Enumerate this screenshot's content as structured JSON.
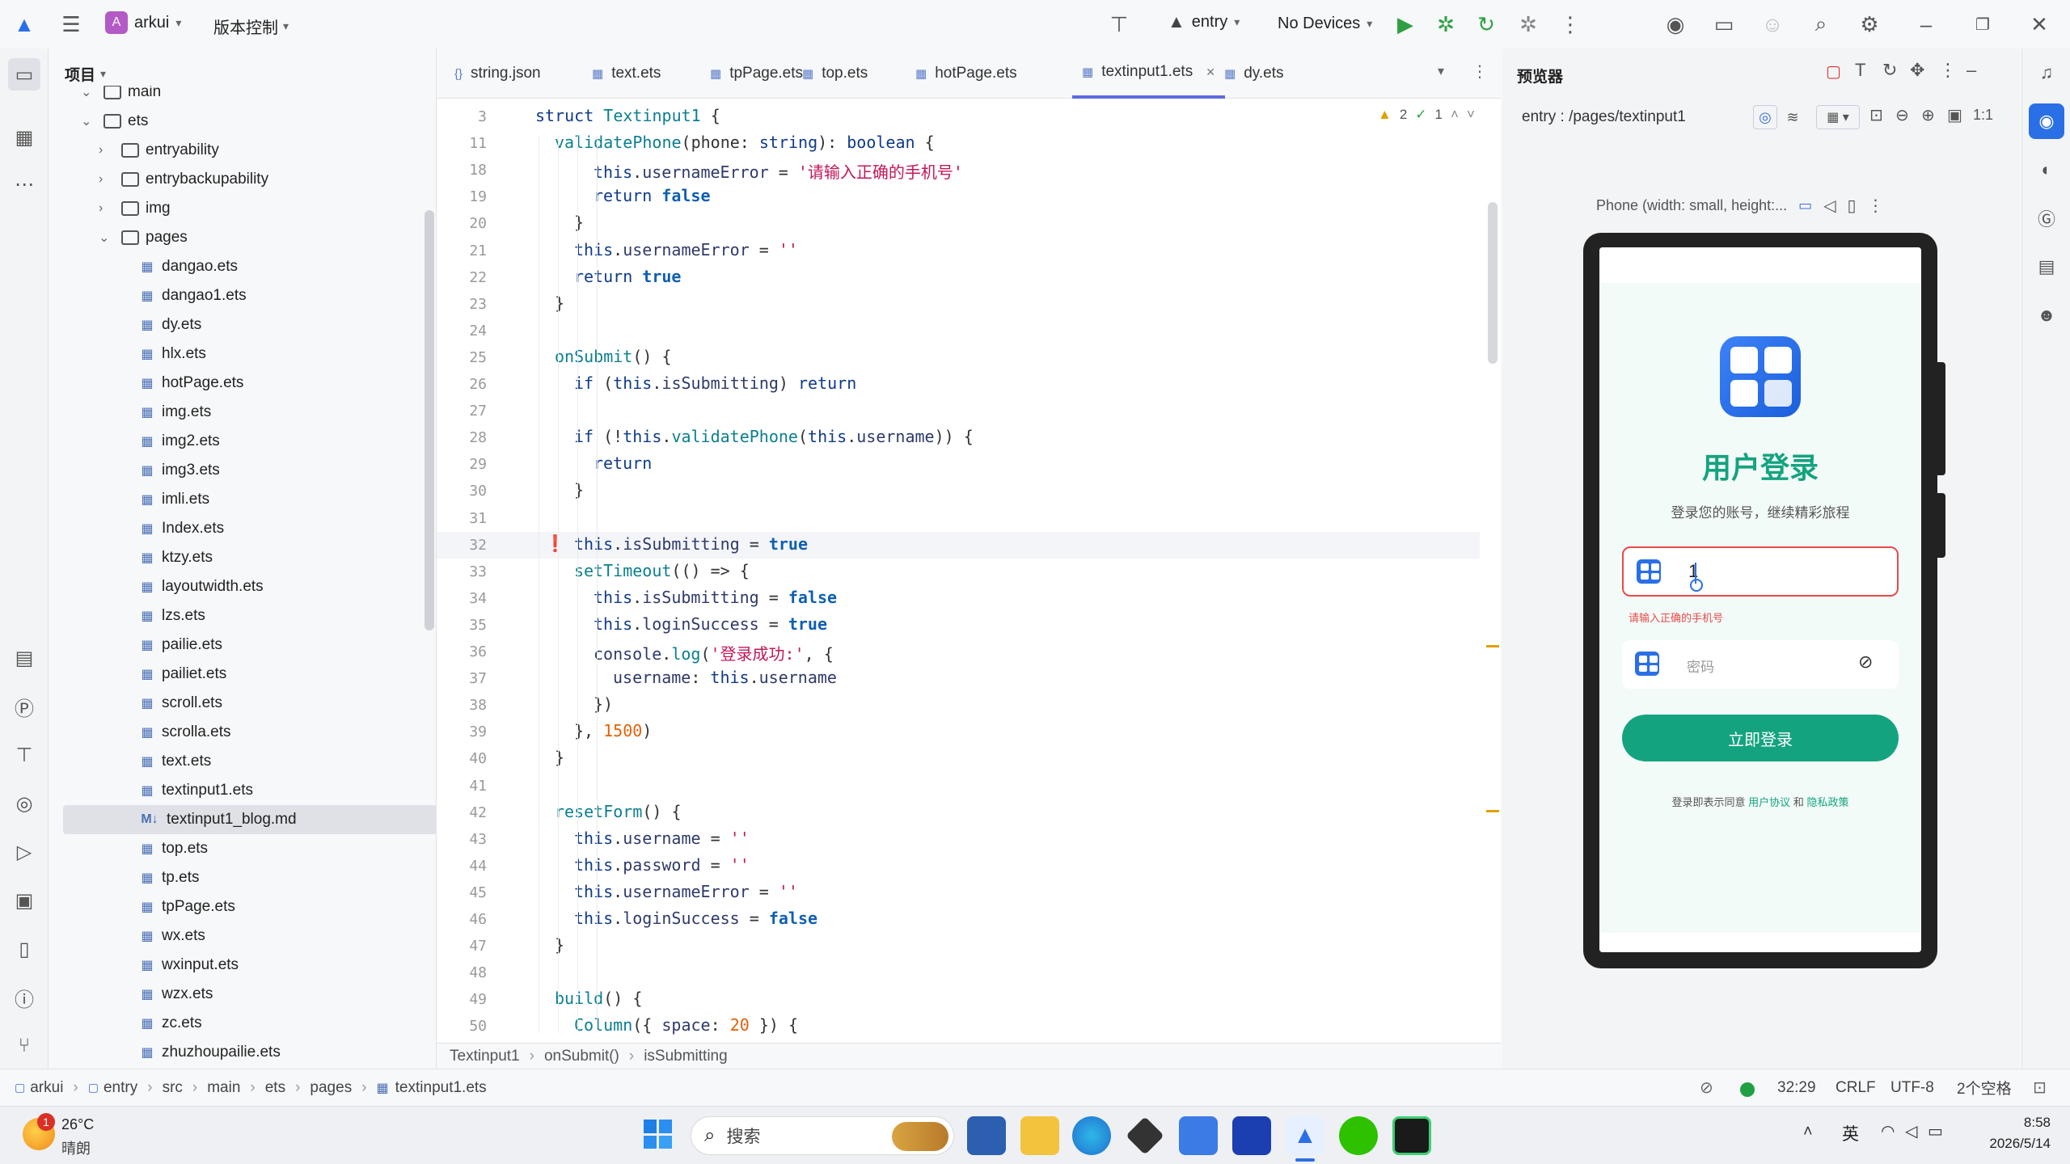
{
  "titlebar": {
    "project_initial": "A",
    "project_name": "arkui",
    "vcs": "版本控制",
    "module": "entry",
    "devices": "No Devices"
  },
  "project_panel": {
    "title": "项目",
    "tree": [
      {
        "label": "main",
        "type": "folder",
        "depth": 1,
        "expanded": true
      },
      {
        "label": "ets",
        "type": "folder",
        "depth": 1,
        "expanded": true
      },
      {
        "label": "entryability",
        "type": "folder",
        "depth": 2,
        "expanded": false
      },
      {
        "label": "entrybackupability",
        "type": "folder",
        "depth": 2,
        "expanded": false
      },
      {
        "label": "img",
        "type": "folder",
        "depth": 2,
        "expanded": false
      },
      {
        "label": "pages",
        "type": "folder",
        "depth": 2,
        "expanded": true
      },
      {
        "label": "dangao.ets",
        "type": "file",
        "depth": 3
      },
      {
        "label": "dangao1.ets",
        "type": "file",
        "depth": 3
      },
      {
        "label": "dy.ets",
        "type": "file",
        "depth": 3
      },
      {
        "label": "hlx.ets",
        "type": "file",
        "depth": 3
      },
      {
        "label": "hotPage.ets",
        "type": "file",
        "depth": 3
      },
      {
        "label": "img.ets",
        "type": "file",
        "depth": 3
      },
      {
        "label": "img2.ets",
        "type": "file",
        "depth": 3
      },
      {
        "label": "img3.ets",
        "type": "file",
        "depth": 3
      },
      {
        "label": "imli.ets",
        "type": "file",
        "depth": 3
      },
      {
        "label": "Index.ets",
        "type": "file",
        "depth": 3
      },
      {
        "label": "ktzy.ets",
        "type": "file",
        "depth": 3
      },
      {
        "label": "layoutwidth.ets",
        "type": "file",
        "depth": 3
      },
      {
        "label": "lzs.ets",
        "type": "file",
        "depth": 3
      },
      {
        "label": "pailie.ets",
        "type": "file",
        "depth": 3
      },
      {
        "label": "pailiet.ets",
        "type": "file",
        "depth": 3
      },
      {
        "label": "scroll.ets",
        "type": "file",
        "depth": 3
      },
      {
        "label": "scrolla.ets",
        "type": "file",
        "depth": 3
      },
      {
        "label": "text.ets",
        "type": "file",
        "depth": 3
      },
      {
        "label": "textinput1.ets",
        "type": "file",
        "depth": 3
      },
      {
        "label": "textinput1_blog.md",
        "type": "md",
        "depth": 3,
        "selected": true
      },
      {
        "label": "top.ets",
        "type": "file",
        "depth": 3
      },
      {
        "label": "tp.ets",
        "type": "file",
        "depth": 3
      },
      {
        "label": "tpPage.ets",
        "type": "file",
        "depth": 3
      },
      {
        "label": "wx.ets",
        "type": "file",
        "depth": 3
      },
      {
        "label": "wxinput.ets",
        "type": "file",
        "depth": 3
      },
      {
        "label": "wzx.ets",
        "type": "file",
        "depth": 3
      },
      {
        "label": "zc.ets",
        "type": "file",
        "depth": 3
      },
      {
        "label": "zhuzhoupailie.ets",
        "type": "file",
        "depth": 3
      }
    ]
  },
  "tabs": [
    {
      "label": "string.json",
      "active": false
    },
    {
      "label": "text.ets",
      "active": false
    },
    {
      "label": "tpPage.ets",
      "active": false
    },
    {
      "label": "top.ets",
      "active": false
    },
    {
      "label": "hotPage.ets",
      "active": false
    },
    {
      "label": "textinput1.ets",
      "active": true
    },
    {
      "label": "dy.ets",
      "active": false
    }
  ],
  "inspections": {
    "warnings": "2",
    "ok": "1"
  },
  "code_lines": [
    {
      "n": "3",
      "indent": 0,
      "html": "<span class='kw'>struct</span> <span class='fn'>Textinput1</span> {"
    },
    {
      "n": "11",
      "indent": 1,
      "html": "<span class='fn'>validatePhone</span>(phone: <span class='kw'>string</span>): <span class='kw'>boolean</span> {"
    },
    {
      "n": "18",
      "indent": 3,
      "html": "<span class='kw'>this</span>.<span class='prop'>usernameError</span> = <span class='str'>'请输入正确的手机号'</span>"
    },
    {
      "n": "19",
      "indent": 3,
      "html": "<span class='kw'>return</span> <span class='tru'>false</span>"
    },
    {
      "n": "20",
      "indent": 2,
      "html": "}"
    },
    {
      "n": "21",
      "indent": 2,
      "html": "<span class='kw'>this</span>.<span class='prop'>usernameError</span> = <span class='str'>''</span>"
    },
    {
      "n": "22",
      "indent": 2,
      "html": "<span class='kw'>return</span> <span class='tru'>true</span>"
    },
    {
      "n": "23",
      "indent": 1,
      "html": "}"
    },
    {
      "n": "24",
      "indent": 0,
      "html": ""
    },
    {
      "n": "25",
      "indent": 1,
      "html": "<span class='fn'>onSubmit</span>() {"
    },
    {
      "n": "26",
      "indent": 2,
      "html": "<span class='kw'>if</span> (<span class='kw'>this</span>.<span class='prop'>isSubmitting</span>) <span class='kw'>return</span>"
    },
    {
      "n": "27",
      "indent": 0,
      "html": ""
    },
    {
      "n": "28",
      "indent": 2,
      "html": "<span class='kw'>if</span> (!<span class='kw'>this</span>.<span class='fn'>validatePhone</span>(<span class='kw'>this</span>.<span class='prop'>username</span>)) {"
    },
    {
      "n": "29",
      "indent": 3,
      "html": "<span class='kw'>return</span>"
    },
    {
      "n": "30",
      "indent": 2,
      "html": "}"
    },
    {
      "n": "31",
      "indent": 0,
      "html": ""
    },
    {
      "n": "32",
      "indent": 2,
      "html": "<span class='kw'>this</span>.<span class='prop'>isSubmitting</span> = <span class='tru'>true</span>",
      "current": true
    },
    {
      "n": "33",
      "indent": 2,
      "html": "<span class='fn'>setTimeout</span>(() => {"
    },
    {
      "n": "34",
      "indent": 3,
      "html": "<span class='kw'>this</span>.<span class='prop'>isSubmitting</span> = <span class='tru'>false</span>"
    },
    {
      "n": "35",
      "indent": 3,
      "html": "<span class='kw'>this</span>.<span class='prop'>loginSuccess</span> = <span class='tru'>true</span>"
    },
    {
      "n": "36",
      "indent": 3,
      "html": "<span class='prop'>console</span>.<span class='fn'>log</span>(<span class='str'>'登录成功:'</span>, {"
    },
    {
      "n": "37",
      "indent": 4,
      "html": "<span class='prop'>username</span>: <span class='kw'>this</span>.<span class='prop'>username</span>"
    },
    {
      "n": "38",
      "indent": 3,
      "html": "})"
    },
    {
      "n": "39",
      "indent": 2,
      "html": "}, <span class='num'>1500</span>)"
    },
    {
      "n": "40",
      "indent": 1,
      "html": "}"
    },
    {
      "n": "41",
      "indent": 0,
      "html": ""
    },
    {
      "n": "42",
      "indent": 1,
      "html": "<span class='fn'>resetForm</span>() {"
    },
    {
      "n": "43",
      "indent": 2,
      "html": "<span class='kw'>this</span>.<span class='prop'>username</span> = <span class='str'>''</span>"
    },
    {
      "n": "44",
      "indent": 2,
      "html": "<span class='kw'>this</span>.<span class='prop'>password</span> = <span class='str'>''</span>"
    },
    {
      "n": "45",
      "indent": 2,
      "html": "<span class='kw'>this</span>.<span class='prop'>usernameError</span> = <span class='str'>''</span>"
    },
    {
      "n": "46",
      "indent": 2,
      "html": "<span class='kw'>this</span>.<span class='prop'>loginSuccess</span> = <span class='tru'>false</span>"
    },
    {
      "n": "47",
      "indent": 1,
      "html": "}"
    },
    {
      "n": "48",
      "indent": 0,
      "html": ""
    },
    {
      "n": "49",
      "indent": 1,
      "html": "<span class='fn'>build</span>() {"
    },
    {
      "n": "50",
      "indent": 2,
      "html": "<span class='fn'>Column</span>({ <span class='prop'>space</span>: <span class='num'>20</span> }) {"
    }
  ],
  "editor_crumbs": [
    "Textinput1",
    "onSubmit()",
    "isSubmitting"
  ],
  "previewer": {
    "title": "预览器",
    "route": "entry : /pages/textinput1",
    "device": "Phone (width: small, height:..."
  },
  "app": {
    "title": "用户登录",
    "subtitle": "登录您的账号，继续精彩旅程",
    "username_value": "1",
    "username_error": "请输入正确的手机号",
    "password_placeholder": "密码",
    "login_button": "立即登录",
    "agree_prefix": "登录即表示同意",
    "agree_user": "用户协议",
    "agree_and": "和",
    "agree_privacy": "隐私政策",
    "accent": "#14a37f"
  },
  "breadcrumb": [
    "arkui",
    "entry",
    "src",
    "main",
    "ets",
    "pages",
    "textinput1.ets"
  ],
  "status": {
    "position": "32:29",
    "line_sep": "CRLF",
    "encoding": "UTF-8",
    "indent": "2个空格"
  },
  "taskbar": {
    "weather_temp": "26°C",
    "weather_desc": "晴朗",
    "weather_badge": "1",
    "search": "搜索",
    "ime": "英",
    "time": "8:58",
    "date": "2026/5/14"
  }
}
